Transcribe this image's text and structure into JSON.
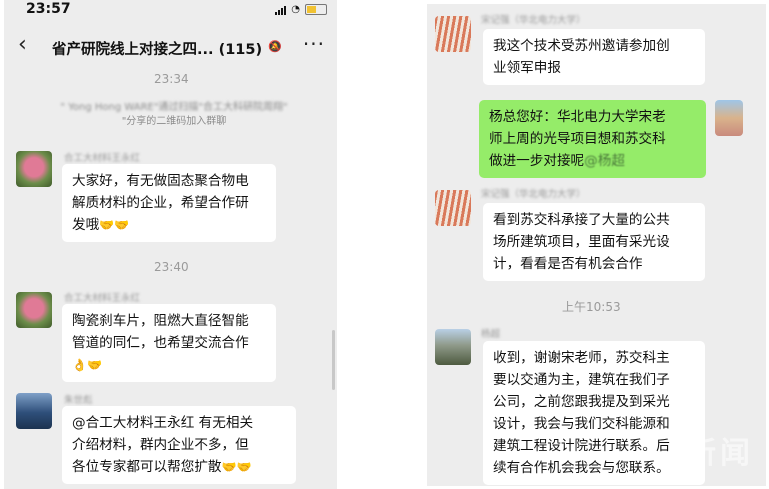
{
  "left": {
    "status_time": "23:57",
    "title": "省产研院线上对接之四...",
    "member_count": "(115)",
    "stamps": [
      "23:34",
      "23:40"
    ],
    "system_msg": {
      "line1": "\" Yong Hong WARE\"通过扫描\"合工大科研院周翔\"",
      "line2": "\"分享的二维码加入群聊"
    },
    "messages": [
      {
        "sender": "合工大材料王永红",
        "lines": [
          "大家好，有无做固态聚合物电",
          "解质材料的企业，希望合作研",
          "发哦"
        ],
        "emoji": "🤝🤝"
      },
      {
        "sender": "合工大材料王永红",
        "lines": [
          "陶瓷刹车片，阻燃大直径智能",
          "管道的同仁，也希望交流合作"
        ],
        "emoji": "👌🤝"
      },
      {
        "sender": "朱世彪",
        "lines": [
          "@合工大材料王永红 有无相关",
          "介绍材料，群内企业不多，但",
          "各位专家都可以帮您扩散"
        ],
        "emoji": "🤝🤝"
      }
    ]
  },
  "right": {
    "stamp": "上午10:53",
    "messages": [
      {
        "sender": "宋记强（华北电力大学）",
        "lines": [
          "我这个技术受苏州邀请参加创",
          "业领军申报"
        ],
        "side": "left"
      },
      {
        "sender": "",
        "lines": [
          "杨总您好：华北电力大学宋老",
          "师上周的光导项目想和苏交科",
          "做进一步对接呢"
        ],
        "mention": "@杨超",
        "side": "right"
      },
      {
        "sender": "宋记强（华北电力大学）",
        "lines": [
          "看到苏交科承接了大量的公共",
          "场所建筑项目，里面有采光设",
          "计，看看是否有机会合作"
        ],
        "side": "left"
      },
      {
        "sender": "杨超",
        "lines": [
          "收到，谢谢宋老师，苏交科主",
          "要以交通为主，建筑在我们子",
          "公司，之前您跟我提及到采光",
          "设计，我会与我们交科能源和",
          "建筑工程设计院进行联系。后",
          "续有合作机会我会与您联系。"
        ],
        "side": "left"
      }
    ],
    "watermark": "新闻"
  }
}
